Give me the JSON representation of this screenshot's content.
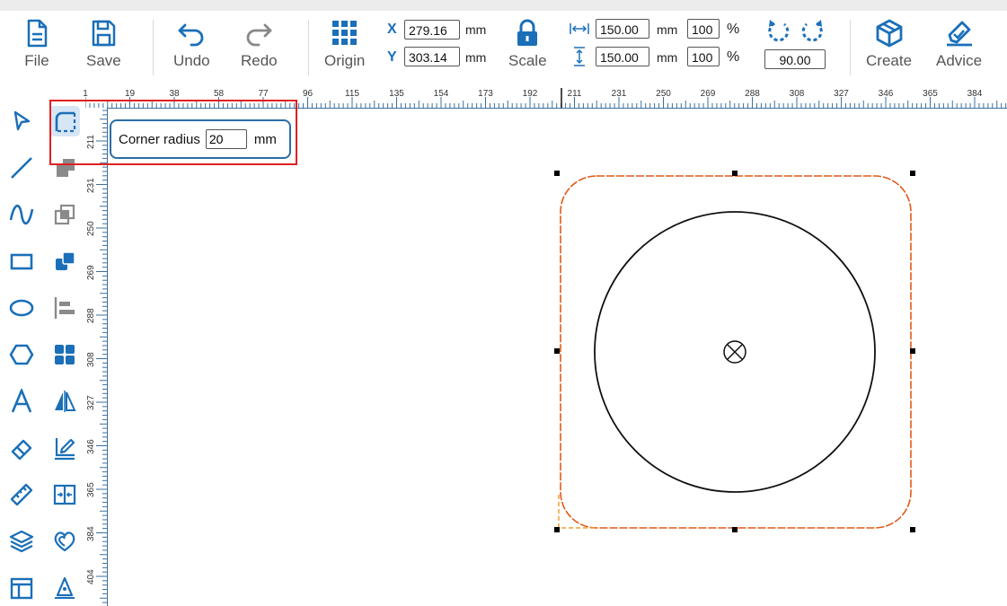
{
  "toolbar": {
    "file_label": "File",
    "save_label": "Save",
    "undo_label": "Undo",
    "redo_label": "Redo",
    "origin_label": "Origin",
    "scale_label": "Scale",
    "create_label": "Create",
    "advice_label": "Advice"
  },
  "position": {
    "x_letter": "X",
    "y_letter": "Y",
    "x_value": "279.16",
    "y_value": "303.14",
    "unit": "mm"
  },
  "size": {
    "width_value": "150.00",
    "height_value": "150.00",
    "width_percent": "100",
    "height_percent": "100",
    "unit": "mm",
    "percent_sign": "%"
  },
  "rotation": {
    "value": "90.00"
  },
  "corner_radius": {
    "label": "Corner radius",
    "value": "20",
    "unit": "mm"
  },
  "ruler": {
    "top_ticks": [
      "1",
      "19",
      "38",
      "58",
      "77",
      "96",
      "115",
      "135",
      "154",
      "173",
      "192",
      "211",
      "231",
      "250",
      "269",
      "288",
      "308",
      "327",
      "346",
      "365",
      "384"
    ],
    "left_ticks": [
      "211",
      "231",
      "250",
      "269",
      "288",
      "308",
      "327",
      "346",
      "365",
      "384",
      "404"
    ]
  },
  "tools_left": [
    "select-tool",
    "line-tool",
    "curve-tool",
    "rectangle-tool",
    "ellipse-tool",
    "polygon-tool",
    "text-tool",
    "eraser-tool",
    "measure-tool",
    "layers-tool",
    "panel-tool"
  ],
  "tools_right": [
    "corner-radius-tool",
    "union-tool",
    "intersect-tool",
    "combine-tool",
    "align-tool",
    "array-tool",
    "mirror-tool",
    "edit-tool",
    "distribute-tool",
    "contour-tool",
    "pen-tool"
  ],
  "colors": {
    "accent": "#1a6fb8",
    "selection_orange": "#e05a1a",
    "highlight_red": "#e02020"
  }
}
